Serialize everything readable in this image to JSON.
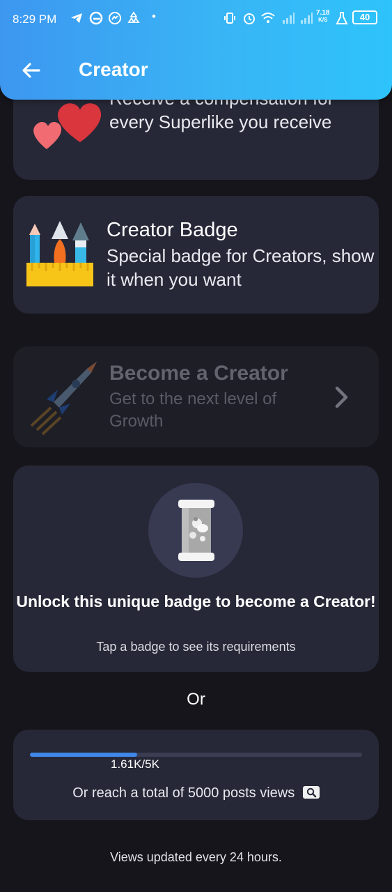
{
  "status_bar": {
    "time": "8:29 PM",
    "net_speed_value": "7.18",
    "net_speed_unit": "K/S",
    "battery": "40"
  },
  "header": {
    "title": "Creator"
  },
  "perks": [
    {
      "description": "Receive a compensation for every Superlike you receive"
    },
    {
      "title": "Creator Badge",
      "description": "Special badge for Creators, show it when you want"
    }
  ],
  "become_creator": {
    "title": "Become a Creator",
    "subtitle": "Get to the next level of Growth"
  },
  "unlock": {
    "headline": "Unlock this unique badge to become a Creator!",
    "hint": "Tap a badge to see its requirements"
  },
  "or_label": "Or",
  "progress": {
    "value_fraction": 0.322,
    "label": "1.61K/5K",
    "text": "Or reach a total of 5000 posts views"
  },
  "footnote": "Views updated every 24 hours.",
  "colors": {
    "accent": "#3d97f0",
    "background": "#16151b",
    "card": "#262837",
    "progress_fill": "#3f87e8"
  }
}
